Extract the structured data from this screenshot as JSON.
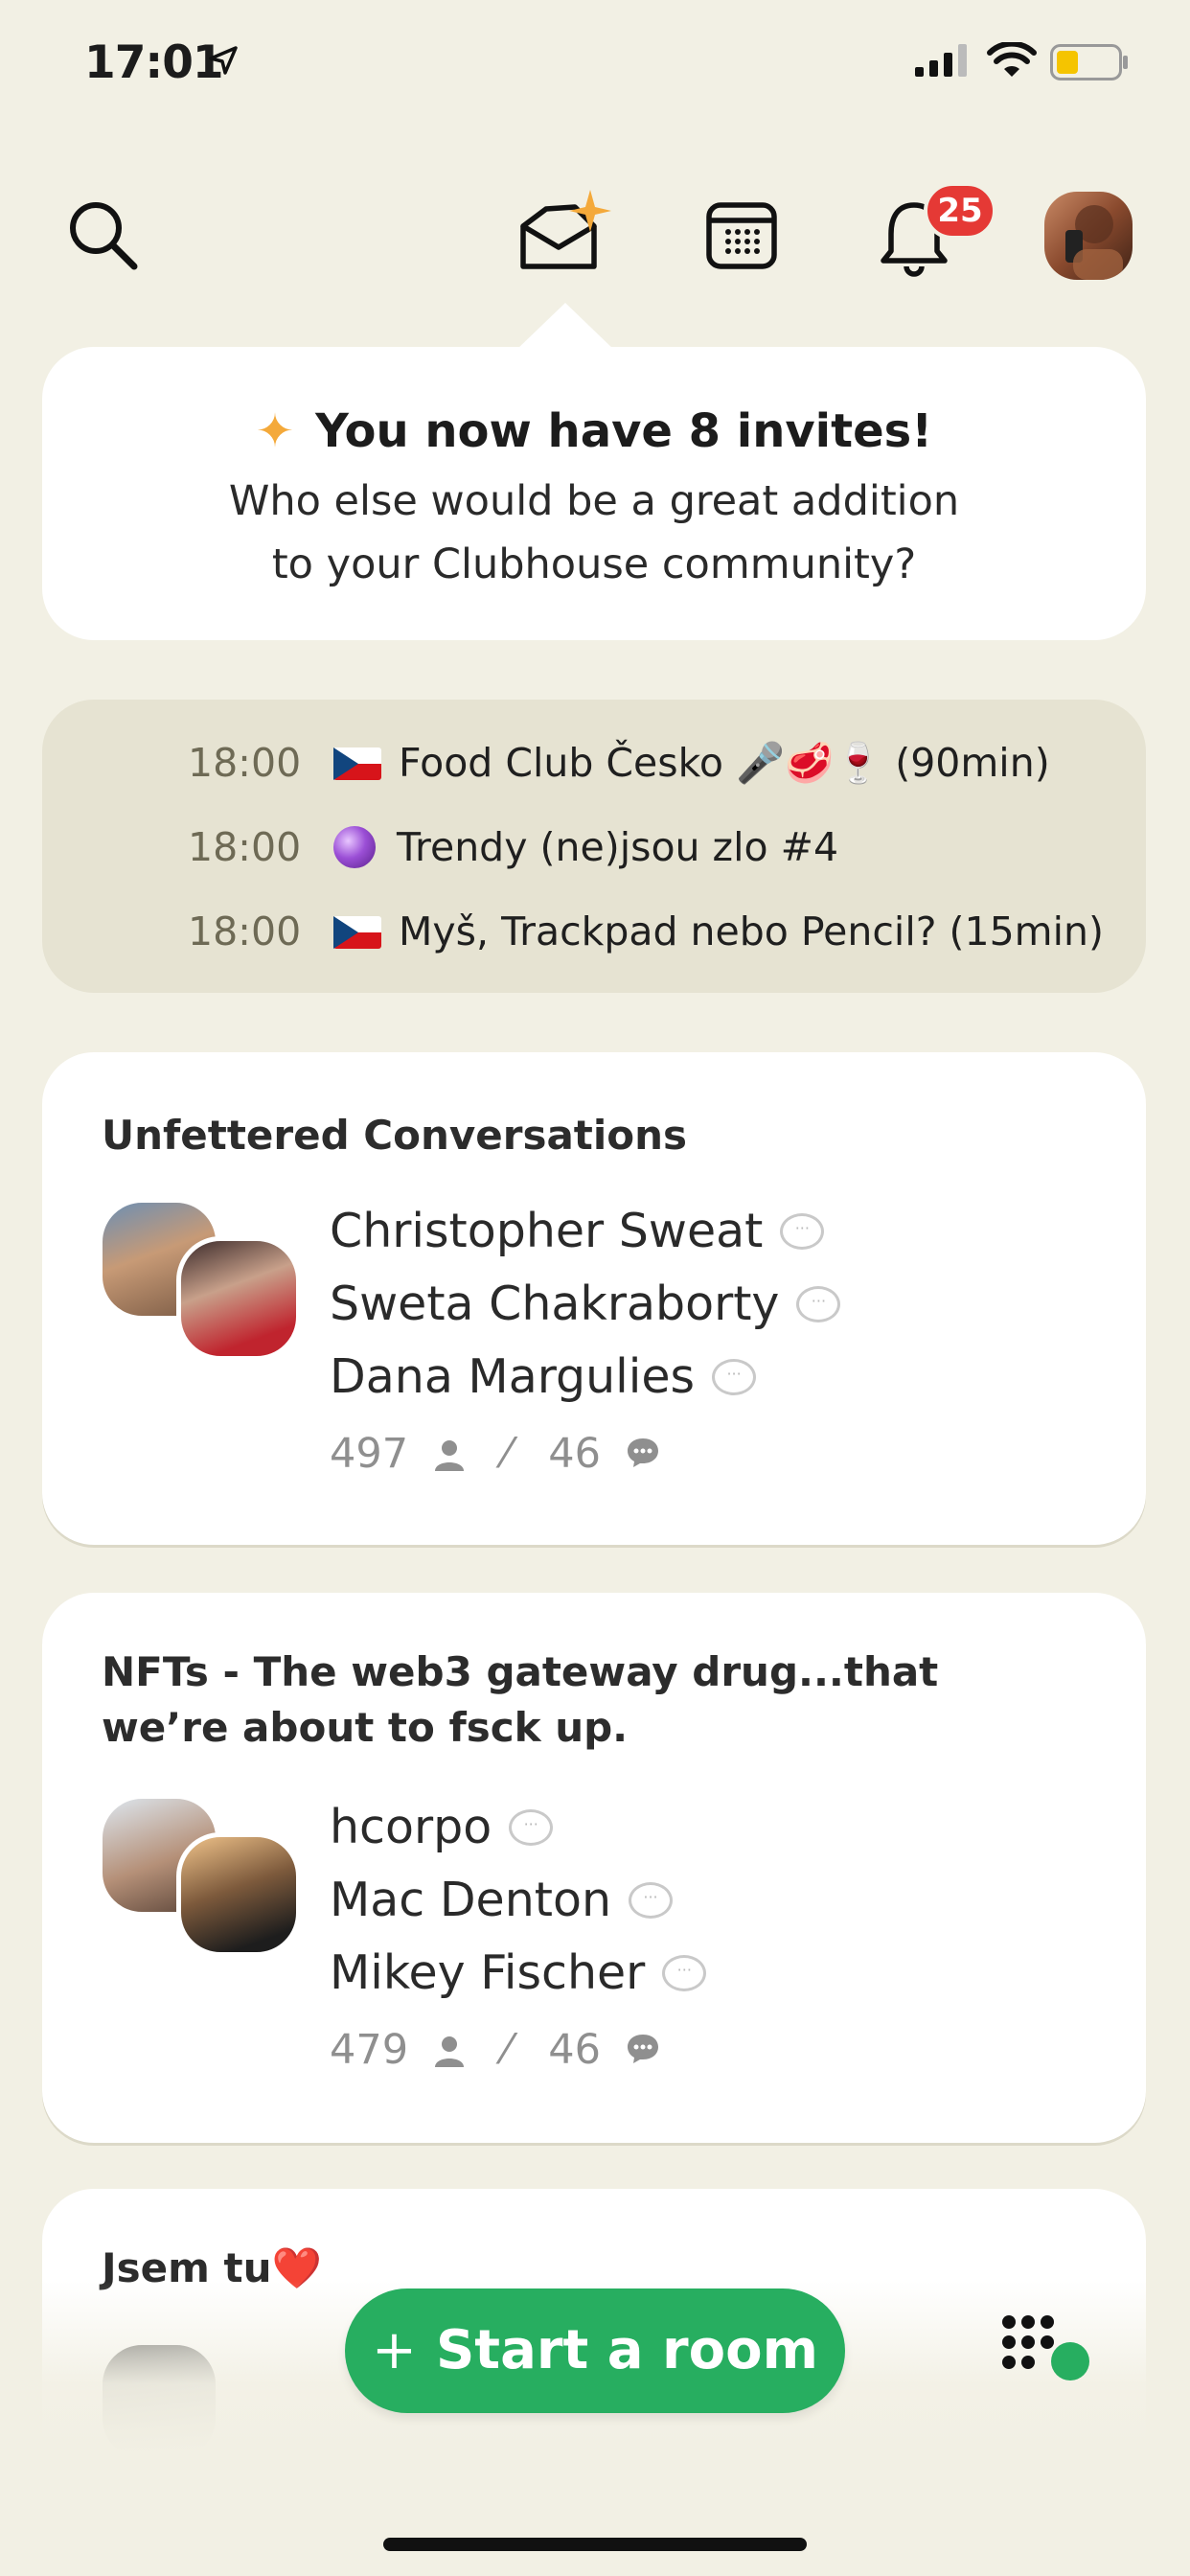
{
  "status_bar": {
    "time": "17:01"
  },
  "nav": {
    "notification_count": "25"
  },
  "invite": {
    "title": "You now have 8 invites!",
    "line1": "Who else would be a great addition",
    "line2": "to your Clubhouse community?"
  },
  "upcoming": [
    {
      "time": "18:00",
      "title": "Food Club Česko 🎤🥩🍷 (90min)"
    },
    {
      "time": "18:00",
      "title": "Trendy (ne)jsou zlo #4"
    },
    {
      "time": "18:00",
      "title": "Myš, Trackpad nebo Pencil? (15min)"
    }
  ],
  "rooms": [
    {
      "title": "Unfettered Conversations",
      "speakers": [
        "Christopher Sweat",
        "Sweta Chakraborty",
        "Dana Margulies"
      ],
      "listeners": "497",
      "speakers_count": "46"
    },
    {
      "title": "NFTs - The web3 gateway drug...that we’re about to fsck up.",
      "speakers": [
        "hcorpo",
        "Mac Denton",
        "Mikey Fischer"
      ],
      "listeners": "479",
      "speakers_count": "46"
    },
    {
      "title": "Jsem tu❤️"
    }
  ],
  "start_room": {
    "label": "Start a room"
  },
  "colors": {
    "accent_green": "#27ae60",
    "badge_red": "#e53935",
    "background": "#f2f0e4"
  }
}
